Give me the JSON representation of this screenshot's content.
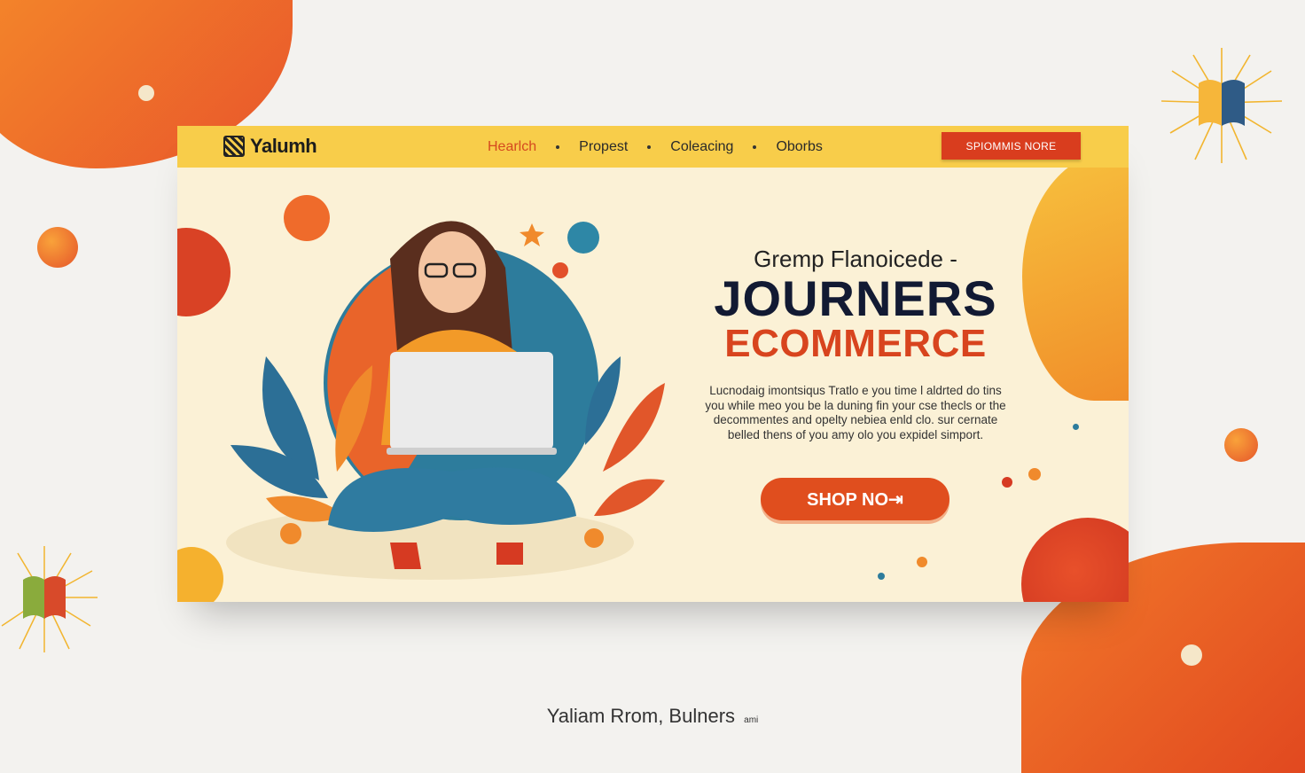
{
  "brand": {
    "name": "Yalumh"
  },
  "nav": {
    "items": [
      "Hearlch",
      "Propest",
      "Coleacing",
      "Oborbs"
    ]
  },
  "top_cta": {
    "label": "SPIOMMIS NORE"
  },
  "hero": {
    "subtitle": "Gremp Flanoicede -",
    "title_line1": "JOURNERS",
    "title_line2": "ECOMMERCE",
    "description_lines": [
      "Lucnodaig imontsiqus Tratlo e you time l aldrted do tins",
      "you while meo you be la duning fin your cse thecls or the",
      "decommentes and opelty nebiea enld clo. sur cernate",
      "belled thens of you amy olo you expidel simport."
    ],
    "shop_button": "SHOP NO⇥"
  },
  "caption": {
    "text": "Yaliam Rrom, Bulners",
    "small": "ami"
  },
  "colors": {
    "accent": "#d93d1e",
    "navbar": "#f8cd4a",
    "hero_bg": "#fbf1d6",
    "title_dark": "#121a33"
  },
  "icons": [
    "book-sunburst-icon",
    "star-icon",
    "laptop-icon"
  ]
}
